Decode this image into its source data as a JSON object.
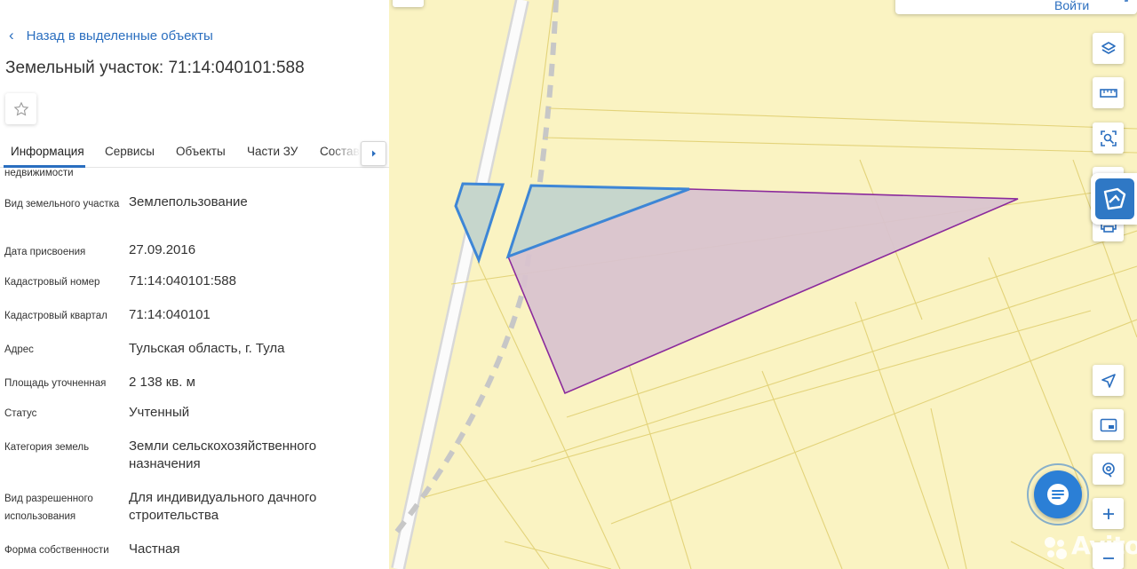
{
  "panel": {
    "back_label": "Назад в выделенные объекты",
    "title": "Земельный участок: 71:14:040101:588",
    "tabs": [
      "Информация",
      "Сервисы",
      "Объекты",
      "Части ЗУ",
      "Состав"
    ],
    "active_tab": "Информация",
    "rows": [
      {
        "label": "недвижимости",
        "value": ""
      },
      {
        "label": "Вид земельного участка",
        "value": "Землепользование"
      },
      {
        "label": "Дата присвоения",
        "value": "27.09.2016"
      },
      {
        "label": "Кадастровый номер",
        "value": "71:14:040101:588"
      },
      {
        "label": "Кадастровый квартал",
        "value": "71:14:040101"
      },
      {
        "label": "Адрес",
        "value": "Тульская область, г. Тула"
      },
      {
        "label": "Площадь уточненная",
        "value": "2 138 кв. м"
      },
      {
        "label": "Статус",
        "value": "Учтенный"
      },
      {
        "label": "Категория земель",
        "value": "Земли сельскохозяйственного назначения"
      },
      {
        "label": "Вид разрешенного использования",
        "value": "Для индивидуального дачного строительства"
      },
      {
        "label": "Форма собственности",
        "value": "Частная"
      }
    ]
  },
  "map": {
    "search_label": "Войти",
    "watermark": "Avito",
    "controls": [
      "layers-icon",
      "ruler-icon",
      "select-area-icon",
      "print-icon",
      "locate-icon",
      "minimap-icon",
      "geo-marker-icon",
      "zoom-in-icon"
    ],
    "colors": {
      "background": "#faf3c2",
      "parcel_outline": "#8b2a9c",
      "parcel_fill": "#d9c3cf",
      "selected_outline": "#3d86d6",
      "selected_fill": "#c6d6cc",
      "accent": "#2a6ebf"
    }
  }
}
